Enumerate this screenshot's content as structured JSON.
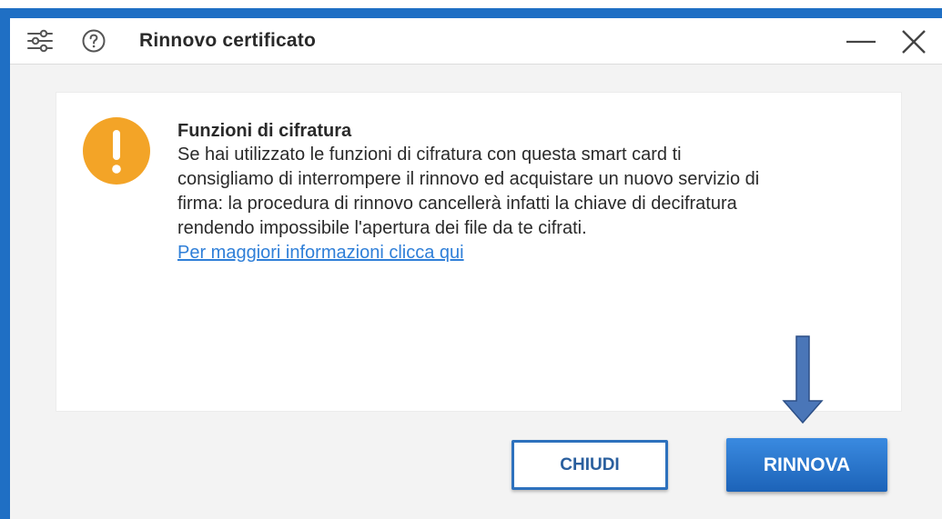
{
  "window": {
    "title": "Rinnovo certificato"
  },
  "icons": {
    "settings": "sliders-icon",
    "help": "question-circle-icon",
    "minimize": "minimize-icon",
    "close": "close-icon",
    "warning": "exclamation-circle-icon",
    "annotation": "down-arrow-icon"
  },
  "message": {
    "title": "Funzioni di cifratura",
    "body_lines": [
      "Se hai utilizzato le funzioni di cifratura con questa smart card ti",
      "consigliamo di interrompere il rinnovo ed acquistare un nuovo servizio di",
      "firma: la procedura di rinnovo cancellerà infatti la chiave di decifratura",
      "rendendo impossibile l'apertura dei file da te cifrati."
    ],
    "link_text": "Per maggiori informazioni clicca qui"
  },
  "buttons": {
    "close_label": "CHIUDI",
    "renew_label": "RINNOVA"
  },
  "colors": {
    "frame": "#1f6fc4",
    "warning": "#f3a427",
    "link": "#2f7fd8",
    "primary_button": "#1f6fc4",
    "annotation_arrow": "#4a76b8"
  }
}
